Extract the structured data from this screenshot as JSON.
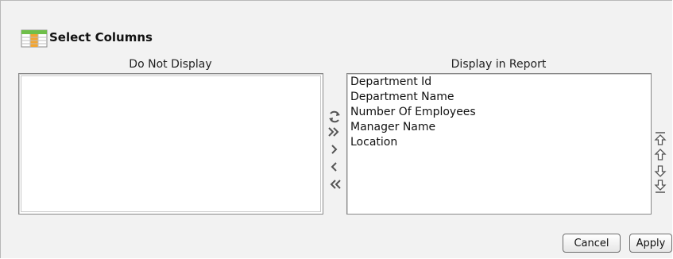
{
  "dialog": {
    "title": "Select Columns",
    "title_icon": "table-columns-icon"
  },
  "left_list": {
    "label": "Do Not Display",
    "items": []
  },
  "right_list": {
    "label": "Display in Report",
    "items": [
      "Department Id",
      "Department Name",
      "Number Of Employees",
      "Manager Name",
      "Location"
    ]
  },
  "transfer_buttons": [
    {
      "name": "reset-icon"
    },
    {
      "name": "move-all-right-icon"
    },
    {
      "name": "move-right-icon"
    },
    {
      "name": "move-left-icon"
    },
    {
      "name": "move-all-left-icon"
    }
  ],
  "order_buttons": [
    {
      "name": "move-top-icon"
    },
    {
      "name": "move-up-icon"
    },
    {
      "name": "move-down-icon"
    },
    {
      "name": "move-bottom-icon"
    }
  ],
  "actions": {
    "cancel_label": "Cancel",
    "apply_label": "Apply"
  },
  "colors": {
    "background": "#f2f2f2",
    "list_background": "#ffffff",
    "icon_green": "#3a8a2a",
    "icon_gray": "#707070"
  }
}
